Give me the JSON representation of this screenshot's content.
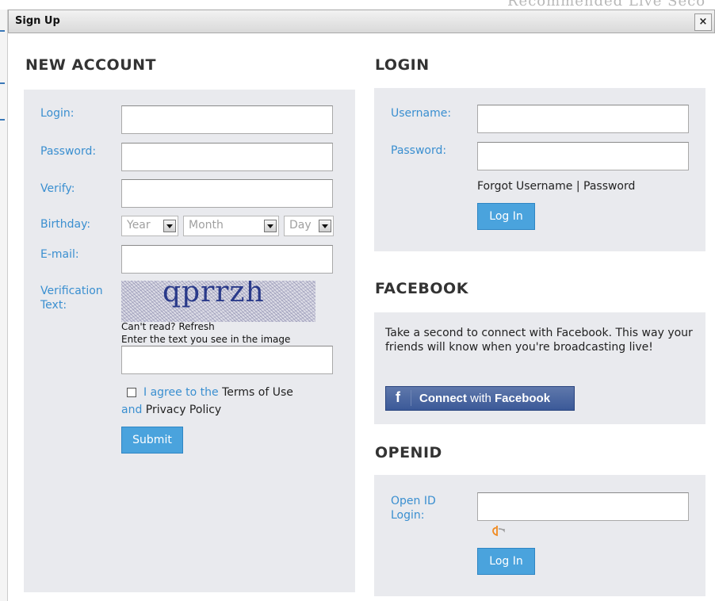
{
  "background": {
    "top_text": "Recommended Live Seco"
  },
  "dialog": {
    "title": "Sign Up",
    "close_label": "×"
  },
  "new_account": {
    "heading": "NEW ACCOUNT",
    "login_label": "Login:",
    "password_label": "Password:",
    "verify_label": "Verify:",
    "birthday_label": "Birthday:",
    "year_value": "Year",
    "month_value": "Month",
    "day_value": "Day",
    "email_label": "E-mail:",
    "verification_label_line1": "Verification",
    "verification_label_line2": "Text:",
    "captcha_text": "qprrzh",
    "cant_read": "Can't read? Refresh",
    "enter_text": "Enter the text you see in the image",
    "agree_prefix": "I agree to the",
    "terms": "Terms of Use",
    "and": "and",
    "privacy": "Privacy Policy",
    "submit_label": "Submit"
  },
  "login": {
    "heading": "LOGIN",
    "username_label": "Username:",
    "password_label": "Password:",
    "forgot_text": "Forgot Username | Password",
    "login_button": "Log In"
  },
  "facebook": {
    "heading": "FACEBOOK",
    "description": "Take a second to connect with Facebook. This way your friends will know when you're broadcasting live!",
    "connect_bold": "Connect",
    "connect_rest": " with ",
    "connect_brand": "Facebook",
    "f_glyph": "f"
  },
  "openid": {
    "heading": "OPENID",
    "label_line1": "Open ID",
    "label_line2": "Login:",
    "login_button": "Log In"
  },
  "colors": {
    "accent_blue": "#3a8fd0",
    "button_blue": "#4aa3dd",
    "panel_bg": "#e9eaee",
    "facebook_blue": "#3b5998"
  }
}
